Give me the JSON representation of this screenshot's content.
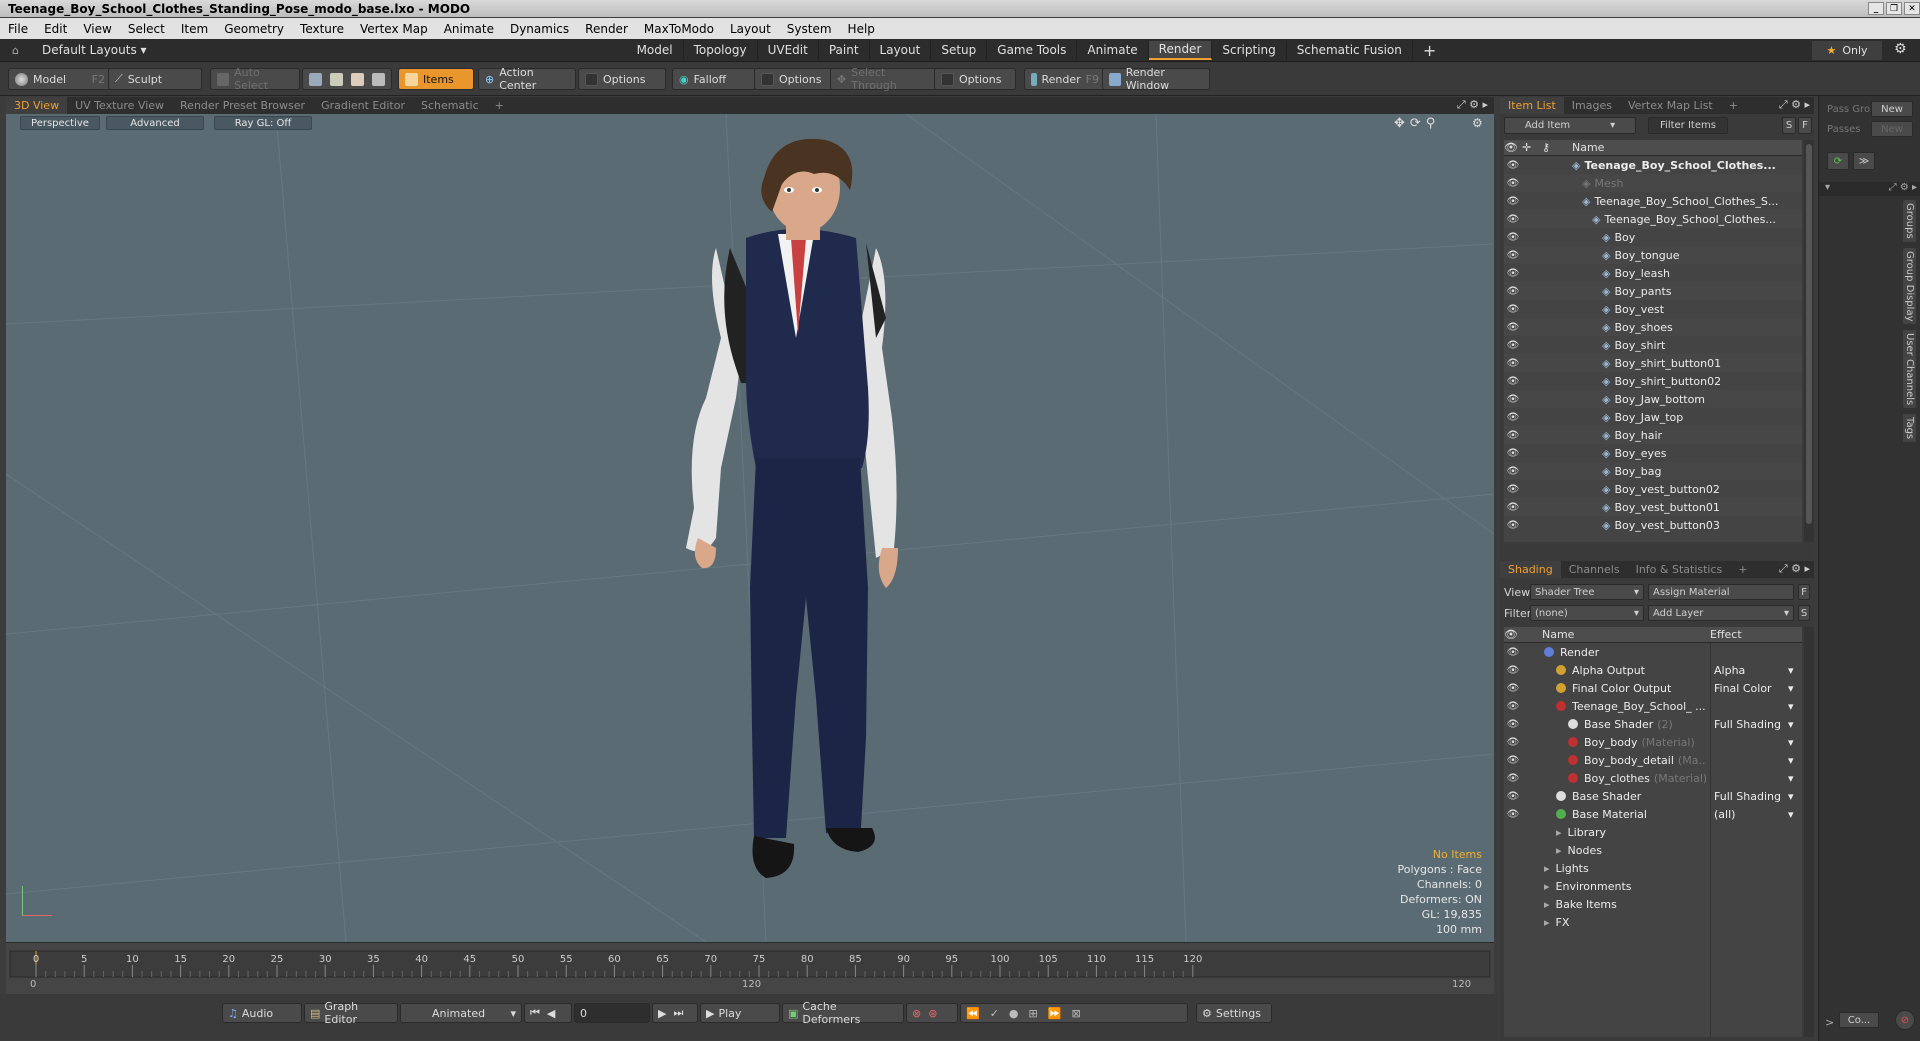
{
  "title": "Teenage_Boy_School_Clothes_Standing_Pose_modo_base.lxo - MODO",
  "menu": [
    "File",
    "Edit",
    "View",
    "Select",
    "Item",
    "Geometry",
    "Texture",
    "Vertex Map",
    "Animate",
    "Dynamics",
    "Render",
    "MaxToModo",
    "Layout",
    "System",
    "Help"
  ],
  "layouts": {
    "current": "Default Layouts",
    "tabs": [
      "Model",
      "Topology",
      "UVEdit",
      "Paint",
      "Layout",
      "Setup",
      "Game Tools",
      "Animate",
      "Render",
      "Scripting",
      "Schematic Fusion"
    ],
    "active": "Render",
    "only": "Only"
  },
  "toolbar": {
    "model": "Model",
    "model_key": "F2",
    "sculpt": "Sculpt",
    "auto_select": "Auto Select",
    "items": "Items",
    "action_center": "Action Center",
    "options": "Options",
    "falloff": "Falloff",
    "options2": "Options",
    "select_through": "Select Through",
    "options3": "Options",
    "render": "Render",
    "render_key": "F9",
    "render_window": "Render Window"
  },
  "view_tabs": [
    "3D View",
    "UV Texture View",
    "Render Preset Browser",
    "Gradient Editor",
    "Schematic"
  ],
  "viewport": {
    "perspective": "Perspective",
    "advanced": "Advanced",
    "raygl": "Ray GL: Off"
  },
  "stats": {
    "items": "No Items",
    "polygons": "Polygons : Face",
    "channels": "Channels: 0",
    "deformers": "Deformers: ON",
    "gl": "GL: 19,835",
    "size": "100 mm"
  },
  "timeline": {
    "ticks": [
      "0",
      "5",
      "10",
      "15",
      "20",
      "25",
      "30",
      "35",
      "40",
      "45",
      "50",
      "55",
      "60",
      "65",
      "70",
      "75",
      "80",
      "85",
      "90",
      "95",
      "100",
      "105",
      "110",
      "115",
      "120"
    ],
    "start": "0",
    "mid": "120",
    "end": "120"
  },
  "bottom": {
    "audio": "Audio",
    "graph_editor": "Graph Editor",
    "animated": "Animated",
    "frame": "0",
    "play": "Play",
    "cache": "Cache Deformers",
    "settings": "Settings"
  },
  "item_list": {
    "tabs": [
      "Item List",
      "Images",
      "Vertex Map List"
    ],
    "add_item": "Add Item",
    "filter": "Filter Items",
    "s": "S",
    "f": "F",
    "col_name": "Name",
    "rows": [
      {
        "label": "Teenage_Boy_School_Clothes...",
        "indent": 0,
        "bold": true
      },
      {
        "label": "Mesh",
        "indent": 1,
        "dim": true
      },
      {
        "label": "Teenage_Boy_School_Clothes_S...",
        "indent": 1
      },
      {
        "label": "Teenage_Boy_School_Clothes...",
        "indent": 2
      },
      {
        "label": "Boy",
        "indent": 3
      },
      {
        "label": "Boy_tongue",
        "indent": 3
      },
      {
        "label": "Boy_leash",
        "indent": 3
      },
      {
        "label": "Boy_pants",
        "indent": 3
      },
      {
        "label": "Boy_vest",
        "indent": 3
      },
      {
        "label": "Boy_shoes",
        "indent": 3
      },
      {
        "label": "Boy_shirt",
        "indent": 3
      },
      {
        "label": "Boy_shirt_button01",
        "indent": 3
      },
      {
        "label": "Boy_shirt_button02",
        "indent": 3
      },
      {
        "label": "Boy_Jaw_bottom",
        "indent": 3
      },
      {
        "label": "Boy_Jaw_top",
        "indent": 3
      },
      {
        "label": "Boy_hair",
        "indent": 3
      },
      {
        "label": "Boy_eyes",
        "indent": 3
      },
      {
        "label": "Boy_bag",
        "indent": 3
      },
      {
        "label": "Boy_vest_button02",
        "indent": 3
      },
      {
        "label": "Boy_vest_button01",
        "indent": 3
      },
      {
        "label": "Boy_vest_button03",
        "indent": 3
      }
    ]
  },
  "shading": {
    "tabs": [
      "Shading",
      "Channels",
      "Info & Statistics"
    ],
    "view_label": "View",
    "view_value": "Shader Tree",
    "assign": "Assign Material",
    "f": "F",
    "filter_label": "Filter",
    "filter_value": "(none)",
    "add_layer": "Add Layer",
    "s": "S",
    "col_name": "Name",
    "col_effect": "Effect",
    "rows": [
      {
        "label": "Render",
        "sub": "",
        "effect": "",
        "indent": 0,
        "color": "#5f7fd8"
      },
      {
        "label": "Alpha Output",
        "sub": "",
        "effect": "Alpha",
        "indent": 1,
        "color": "#d2a030"
      },
      {
        "label": "Final Color Output",
        "sub": "",
        "effect": "Final Color",
        "indent": 1,
        "color": "#d2a030"
      },
      {
        "label": "Teenage_Boy_School_ ...",
        "sub": "",
        "effect": "",
        "indent": 1,
        "color": "#c03030"
      },
      {
        "label": "Base Shader",
        "sub": "(2)",
        "effect": "Full Shading",
        "indent": 2,
        "color": "#dddddd"
      },
      {
        "label": "Boy_body",
        "sub": "(Material)",
        "effect": "",
        "indent": 2,
        "color": "#c03030"
      },
      {
        "label": "Boy_body_detail",
        "sub": "(Ma...",
        "effect": "",
        "indent": 2,
        "color": "#c03030"
      },
      {
        "label": "Boy_clothes",
        "sub": "(Material)",
        "effect": "",
        "indent": 2,
        "color": "#c03030"
      },
      {
        "label": "Base Shader",
        "sub": "",
        "effect": "Full Shading",
        "indent": 1,
        "color": "#dddddd"
      },
      {
        "label": "Base Material",
        "sub": "",
        "effect": "(all)",
        "indent": 1,
        "color": "#50b050"
      },
      {
        "label": "Library",
        "sub": "",
        "effect": "",
        "indent": 1,
        "color": ""
      },
      {
        "label": "Nodes",
        "sub": "",
        "effect": "",
        "indent": 1,
        "color": ""
      },
      {
        "label": "Lights",
        "sub": "",
        "effect": "",
        "indent": 0,
        "color": ""
      },
      {
        "label": "Environments",
        "sub": "",
        "effect": "",
        "indent": 0,
        "color": ""
      },
      {
        "label": "Bake Items",
        "sub": "",
        "effect": "",
        "indent": 0,
        "color": ""
      },
      {
        "label": "FX",
        "sub": "",
        "effect": "",
        "indent": 0,
        "color": ""
      }
    ]
  },
  "pass": {
    "group": "Pass Gro",
    "new1": "New",
    "passes": "Passes",
    "new2": "New",
    "vtabs": [
      "Groups",
      "Group Display",
      "User Channels",
      "Tags"
    ],
    "co": "Co..."
  }
}
